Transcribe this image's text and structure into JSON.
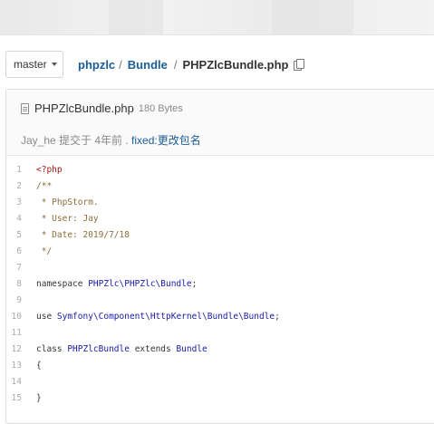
{
  "branch": {
    "name": "master"
  },
  "breadcrumb": {
    "owner": "phpzlc",
    "repo": "Bundle",
    "file": "PHPZlcBundle.php"
  },
  "file": {
    "name": "PHPZlcBundle.php",
    "size": "180 Bytes",
    "commit": {
      "info": "Jay_he 提交于 4年前 . ",
      "message": "fixed:更改包名"
    }
  },
  "code": {
    "lines": [
      {
        "n": "1",
        "tokens": [
          {
            "t": "<?php",
            "k": "meta"
          }
        ]
      },
      {
        "n": "2",
        "tokens": [
          {
            "t": "/**",
            "k": "comment"
          }
        ]
      },
      {
        "n": "3",
        "tokens": [
          {
            "t": " * PhpStorm.",
            "k": "comment"
          }
        ]
      },
      {
        "n": "4",
        "tokens": [
          {
            "t": " * User: Jay",
            "k": "comment"
          }
        ]
      },
      {
        "n": "5",
        "tokens": [
          {
            "t": " * Date: 2019/7/18",
            "k": "comment"
          }
        ]
      },
      {
        "n": "6",
        "tokens": [
          {
            "t": " */",
            "k": "comment"
          }
        ]
      },
      {
        "n": "7",
        "tokens": []
      },
      {
        "n": "8",
        "tokens": [
          {
            "t": "namespace ",
            "k": "kw"
          },
          {
            "t": "PHPZlc\\PHPZlc\\Bundle",
            "k": "ns"
          },
          {
            "t": ";",
            "k": "plain"
          }
        ]
      },
      {
        "n": "9",
        "tokens": []
      },
      {
        "n": "10",
        "tokens": [
          {
            "t": "use ",
            "k": "kw"
          },
          {
            "t": "Symfony\\Component\\HttpKernel\\Bundle\\Bundle",
            "k": "ns"
          },
          {
            "t": ";",
            "k": "plain"
          }
        ]
      },
      {
        "n": "11",
        "tokens": []
      },
      {
        "n": "12",
        "tokens": [
          {
            "t": "class ",
            "k": "kw"
          },
          {
            "t": "PHPZlcBundle",
            "k": "ns"
          },
          {
            "t": " extends ",
            "k": "kw"
          },
          {
            "t": "Bundle",
            "k": "ns"
          }
        ]
      },
      {
        "n": "13",
        "tokens": [
          {
            "t": "{",
            "k": "plain"
          }
        ]
      },
      {
        "n": "14",
        "tokens": []
      },
      {
        "n": "15",
        "tokens": [
          {
            "t": "}",
            "k": "plain"
          }
        ]
      }
    ]
  }
}
